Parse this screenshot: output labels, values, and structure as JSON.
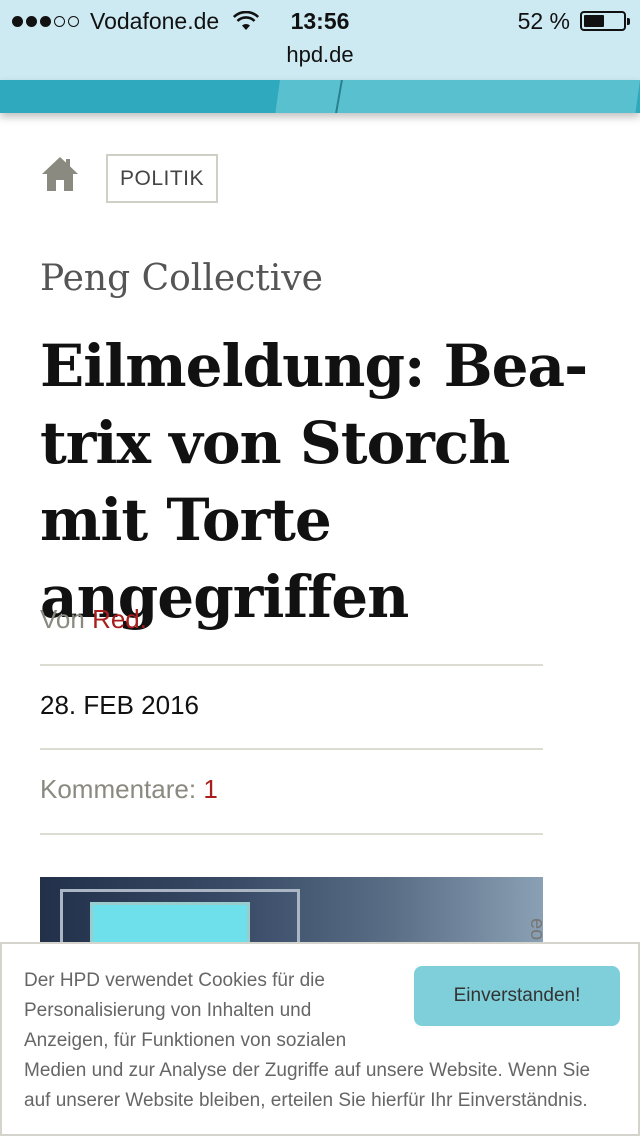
{
  "status_bar": {
    "carrier": "Vodafone.de",
    "time": "13:56",
    "battery_percent": "52 %",
    "battery_level": 0.52,
    "url": "hpd.de"
  },
  "breadcrumb": {
    "category": "POLITIK"
  },
  "article": {
    "kicker": "Peng Collective",
    "title": "Eilmeldung: Bea-trix von Storch mit Torte angegriffen",
    "author_prefix": "Von",
    "author": "Red.",
    "date": "28. FEB 2016",
    "comments_label": "Kommentare:",
    "comments_count": "1"
  },
  "cookie_banner": {
    "text": "Der HPD verwendet Cookies für die Personalisierung von Inhalten und Anzeigen, für Funktionen von sozialen Medien und zur Analyse der Zugriffe auf unsere Website. Wenn Sie auf unserer Website bleiben, erteilen Sie hierfür Ihr Einverständnis.",
    "button_label": "Einverstanden!"
  },
  "colors": {
    "accent_teal": "#2fa9bd",
    "link_red": "#a81e1e",
    "button_teal": "#7fcfda"
  }
}
